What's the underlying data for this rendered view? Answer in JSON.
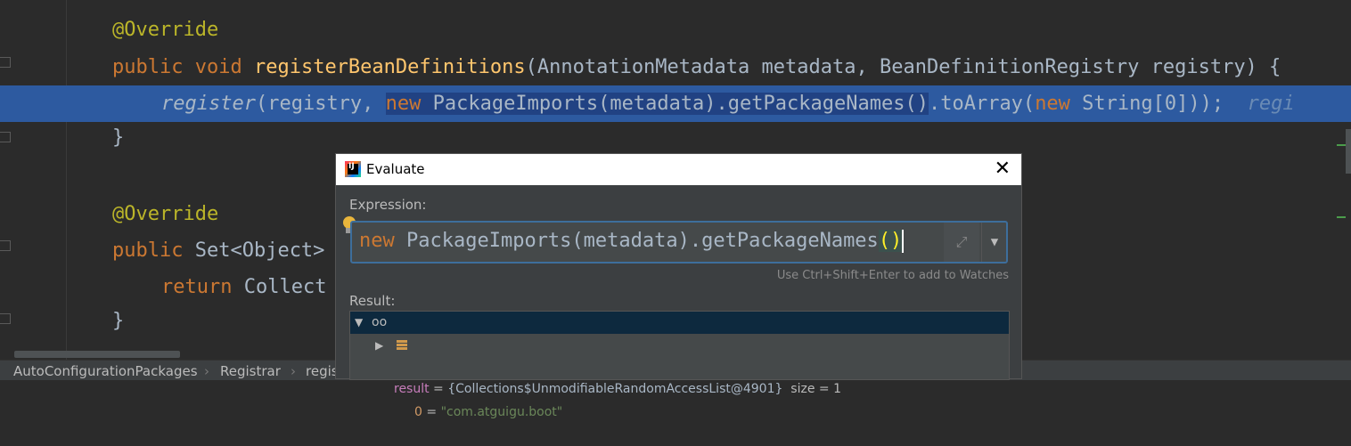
{
  "editor": {
    "line1": {
      "annotation": "@Override"
    },
    "line2": {
      "kw1": "public",
      "kw2": "void",
      "method": "registerBeanDefinitions",
      "params": "(AnnotationMetadata metadata, BeanDefinitionRegistry registry) {"
    },
    "line3": {
      "call": "register",
      "args_start": "(registry, ",
      "sel_kw": "new",
      "sel_text": " PackageImports(metadata).getPackageNames()",
      "rest_a": ".toArray(",
      "rest_kw": "new",
      "rest_b": " String[0]));",
      "inline_hint": "regi"
    },
    "line4": {
      "text": "}"
    },
    "line5": {
      "annotation": "@Override"
    },
    "line6": {
      "kw": "public",
      "text": " Set<Object>"
    },
    "line7": {
      "kw": "return",
      "text": " Collect"
    },
    "line8": {
      "text": "}"
    }
  },
  "breadcrumb": {
    "items": [
      "AutoConfigurationPackages",
      "Registrar",
      "regis"
    ],
    "separator": "›"
  },
  "dialog": {
    "title": "Evaluate",
    "logo_text": "IJ",
    "close_glyph": "✕",
    "expression_label": "Expression:",
    "expression": {
      "kw": "new",
      "text": " PackageImports(metadata).getPackageNames",
      "parens": "()"
    },
    "expand_glyph": "⤢",
    "dropdown_glyph": "▼",
    "hint": "Use Ctrl+Shift+Enter to add to Watches",
    "result_label": "Result:",
    "result": {
      "row1": {
        "name": "result",
        "eq": " = ",
        "value": "{Collections$UnmodifiableRandomAccessList@4901}",
        "size": "  size = 1"
      },
      "row2": {
        "index": "0",
        "eq": " = ",
        "value": "\"com.atguigu.boot\""
      }
    }
  }
}
